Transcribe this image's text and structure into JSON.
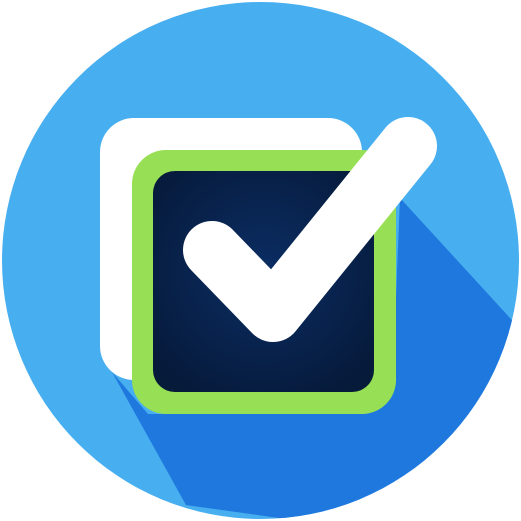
{
  "icon": {
    "name": "checkbox-checked-icon",
    "checked": true
  },
  "colors": {
    "circle_background": "#47aef0",
    "long_shadow": "#1f78de",
    "outer_frame": "#ffffff",
    "box_border": "#97df55",
    "box_fill_center": "#0b2d63",
    "box_fill_edge": "#061a3a",
    "checkmark": "#ffffff",
    "page_background": "#ffffff"
  }
}
